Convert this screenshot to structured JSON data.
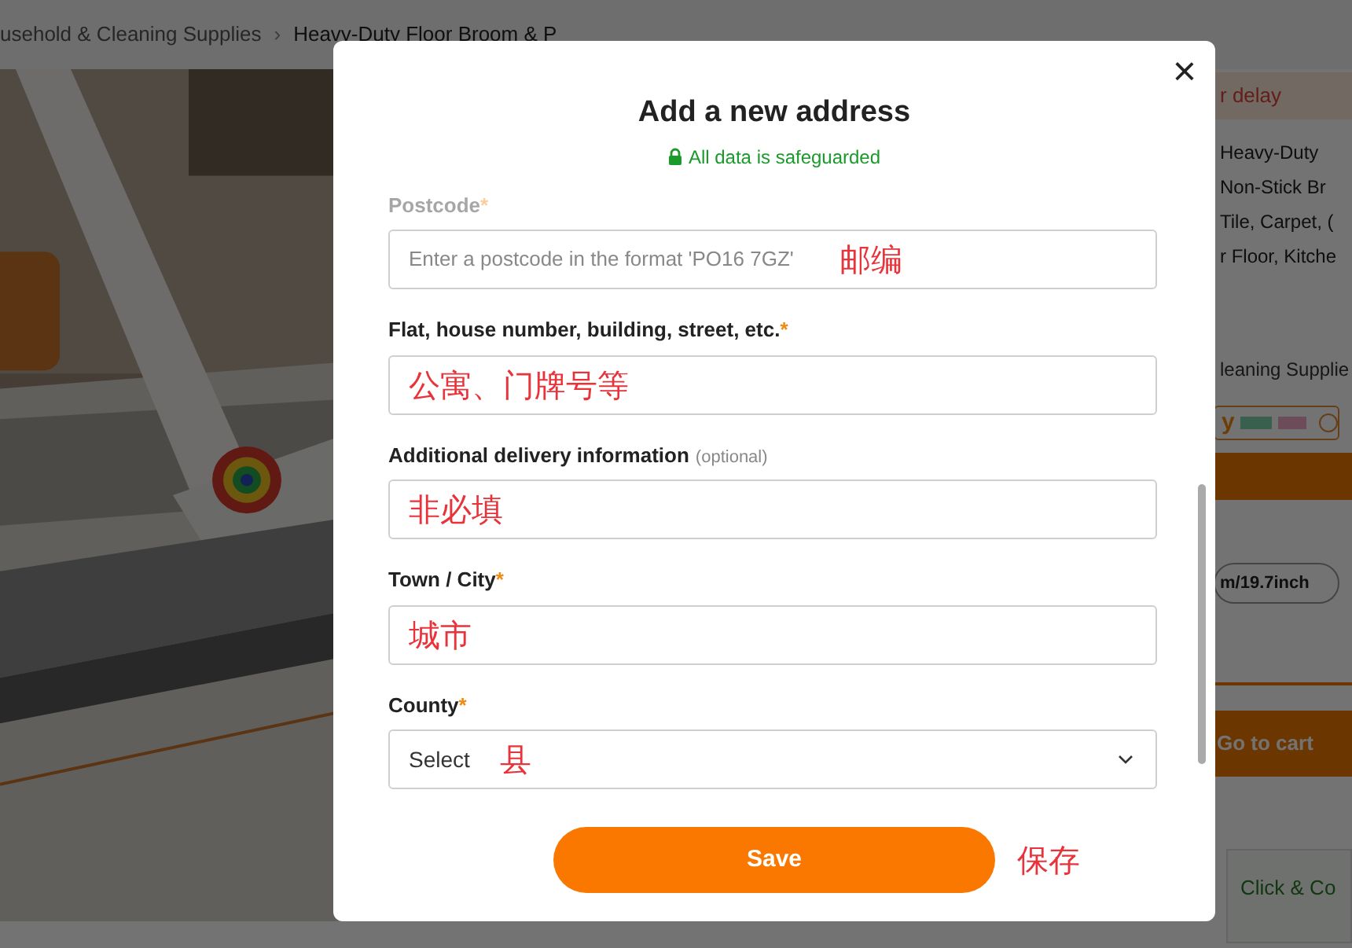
{
  "breadcrumb": {
    "items": [
      "usehold & Cleaning Supplies",
      "Heavy-Duty Floor Broom & P"
    ],
    "separator": "›"
  },
  "product_panel": {
    "delivery_notice": "r delay",
    "title_lines": [
      "Heavy-Duty",
      "Non-Stick Br",
      "Tile, Carpet, (",
      "r Floor, Kitche"
    ],
    "category": "leaning Supplie",
    "brand_fragment": "y",
    "size_option": "m/19.7inch",
    "cart_button": "Go to cart",
    "collect_option": "Click & Co"
  },
  "dialog": {
    "title": "Add a new address",
    "subtitle": "All data is safeguarded",
    "close": "×",
    "fields": [
      {
        "kind": "text",
        "label": "Postcode",
        "required_mark": "*",
        "faded": true,
        "placeholder": "Enter a postcode in the format 'PO16 7GZ'",
        "annotation": "邮编"
      },
      {
        "kind": "text",
        "label": "Flat, house number, building, street, etc.",
        "required_mark": "*",
        "faded": false,
        "annotation": "公寓、门牌号等"
      },
      {
        "kind": "text",
        "label": "Additional delivery information",
        "optional_note": "(optional)",
        "faded": false,
        "annotation": "非必填"
      },
      {
        "kind": "text",
        "label": "Town / City",
        "required_mark": "*",
        "faded": false,
        "annotation": "城市"
      },
      {
        "kind": "select",
        "label": "County",
        "required_mark": "*",
        "faded": false,
        "value": "Select",
        "annotation": "县"
      }
    ],
    "save_button": "Save",
    "save_annotation": "保存"
  }
}
